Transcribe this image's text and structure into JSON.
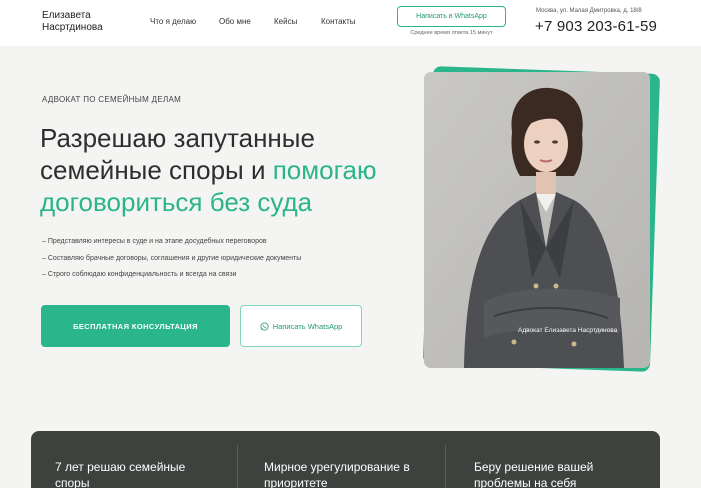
{
  "header": {
    "logo_line1": "Елизавета",
    "logo_line2": "Насртдинова",
    "nav": [
      "Что я делаю",
      "Обо мне",
      "Кейсы",
      "Контакты"
    ],
    "whatsapp_button": "Написать в WhatsApp",
    "response_note": "Среднее время ответа 15 минут",
    "address": "Москва, ул. Малая Дмитровка, д. 18/8",
    "phone": "+7 903 203-61-59"
  },
  "hero": {
    "eyebrow": "АДВОКАТ ПО СЕМЕЙНЫМ ДЕЛАМ",
    "headline_part1": "Разрешаю запутанные семейные споры и ",
    "headline_accent": "помогаю договориться без суда",
    "bullets": [
      "– Представляю интересы в суде и на этапе досудебных переговоров",
      "– Составляю брачные договоры, соглашения и другие юридические документы",
      "– Строго соблюдаю конфиденциальность и всегда на связи"
    ],
    "consult_button": "БЕСПЛАТНАЯ КОНСУЛЬТАЦИЯ",
    "whatsapp_button": "Написать WhatsApp",
    "photo_caption": "Адвокат Елизавета Насртдинова"
  },
  "stats": [
    "7 лет решаю семейные споры",
    "Мирное урегулирование в приоритете",
    "Беру решение вашей проблемы на себя"
  ],
  "colors": {
    "accent": "#2ab58a",
    "dark_panel": "#3d423f",
    "background": "#f4f4f3"
  }
}
